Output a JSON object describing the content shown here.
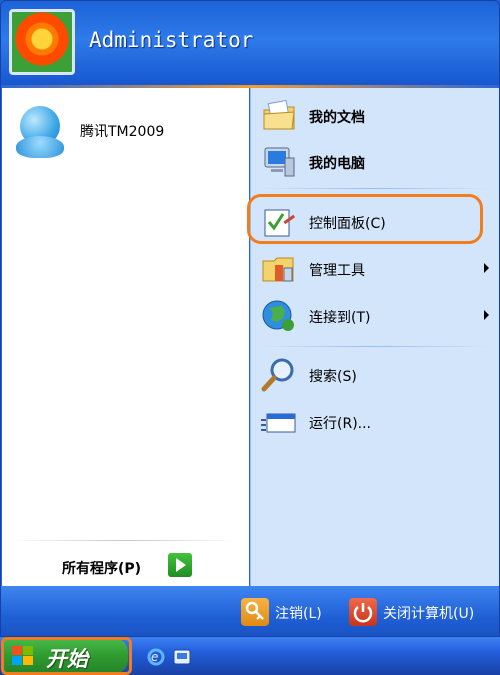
{
  "header": {
    "username": "Administrator"
  },
  "left_pane": {
    "pinned_items": [
      {
        "label": "腾讯TM2009",
        "icon": "qq-penguin-icon"
      }
    ],
    "all_programs_label": "所有程序(P)"
  },
  "right_pane": {
    "items": [
      {
        "label": "我的文档",
        "icon": "my-documents-icon",
        "bold": true,
        "submenu": false
      },
      {
        "label": "我的电脑",
        "icon": "my-computer-icon",
        "bold": true,
        "submenu": false
      },
      {
        "label": "控制面板(C)",
        "icon": "control-panel-icon",
        "bold": false,
        "submenu": false
      },
      {
        "label": "管理工具",
        "icon": "admin-tools-icon",
        "bold": false,
        "submenu": true
      },
      {
        "label": "连接到(T)",
        "icon": "connect-to-icon",
        "bold": false,
        "submenu": true
      },
      {
        "label": "搜索(S)",
        "icon": "search-icon",
        "bold": false,
        "submenu": false
      },
      {
        "label": "运行(R)...",
        "icon": "run-icon",
        "bold": false,
        "submenu": false
      }
    ]
  },
  "footer": {
    "logoff_label": "注销(L)",
    "shutdown_label": "关闭计算机(U)"
  },
  "taskbar": {
    "start_label": "开始",
    "quick_launch": [
      "internet-explorer-icon",
      "show-desktop-icon"
    ]
  },
  "colors": {
    "highlight": "#f07e1f",
    "menu_blue": "#2a68d8",
    "right_pane": "#d3e5fa"
  }
}
